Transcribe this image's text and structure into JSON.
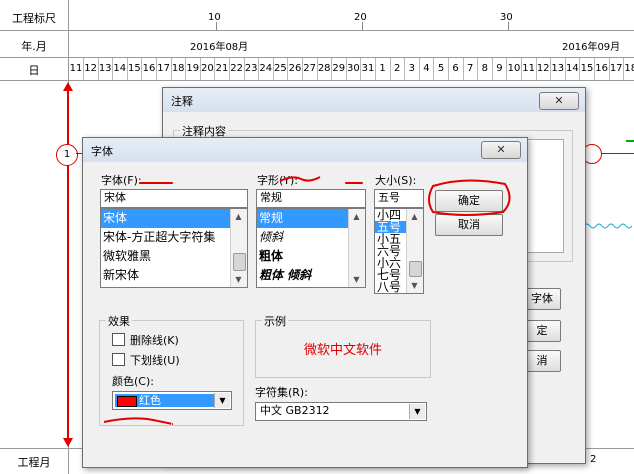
{
  "gantt": {
    "row_labels": {
      "ruler": "工程标尺",
      "year_month": "年.月",
      "day": "日",
      "bottom": "工程月"
    },
    "ruler_ticks": [
      "10",
      "20",
      "30"
    ],
    "months": [
      "2016年08月",
      "2016年09月"
    ],
    "days": [
      "11",
      "12",
      "13",
      "14",
      "15",
      "16",
      "17",
      "18",
      "19",
      "20",
      "21",
      "22",
      "23",
      "24",
      "25",
      "26",
      "27",
      "28",
      "29",
      "30",
      "31",
      "1",
      "2",
      "3",
      "4",
      "5",
      "6",
      "7",
      "8",
      "9",
      "10",
      "11",
      "12",
      "13",
      "14",
      "15",
      "16",
      "17",
      "18"
    ],
    "bottom_value": "2",
    "node_label": "1"
  },
  "note_dialog": {
    "title": "注释",
    "close": "✕",
    "group_label": "注释内容",
    "button_font": "字体",
    "button_ok_partial": "定",
    "button_cancel_partial": "消"
  },
  "font_dialog": {
    "title": "字体",
    "close": "✕",
    "font_label": "字体(F):",
    "font_value": "宋体",
    "font_options": [
      "宋体",
      "宋体-方正超大字符集",
      "微软雅黑",
      "新宋体"
    ],
    "style_label": "字形(Y):",
    "style_value": "常规",
    "style_options": [
      "常规",
      "倾斜",
      "粗体",
      "粗体 倾斜"
    ],
    "size_label": "大小(S):",
    "size_value": "五号",
    "size_options": [
      "小四",
      "五号",
      "小五",
      "六号",
      "小六",
      "七号",
      "八号"
    ],
    "ok": "确定",
    "cancel": "取消",
    "effects_label": "效果",
    "strikeout": "删除线(K)",
    "underline": "下划线(U)",
    "color_label": "颜色(C):",
    "color_value": "红色",
    "sample_label": "示例",
    "sample_text": "微软中文软件",
    "charset_label": "字符集(R):",
    "charset_value": "中文 GB2312"
  },
  "colors": {
    "annotation_red": "#e00000",
    "selection_blue": "#3399ff",
    "color_swatch": "#ff0000"
  }
}
